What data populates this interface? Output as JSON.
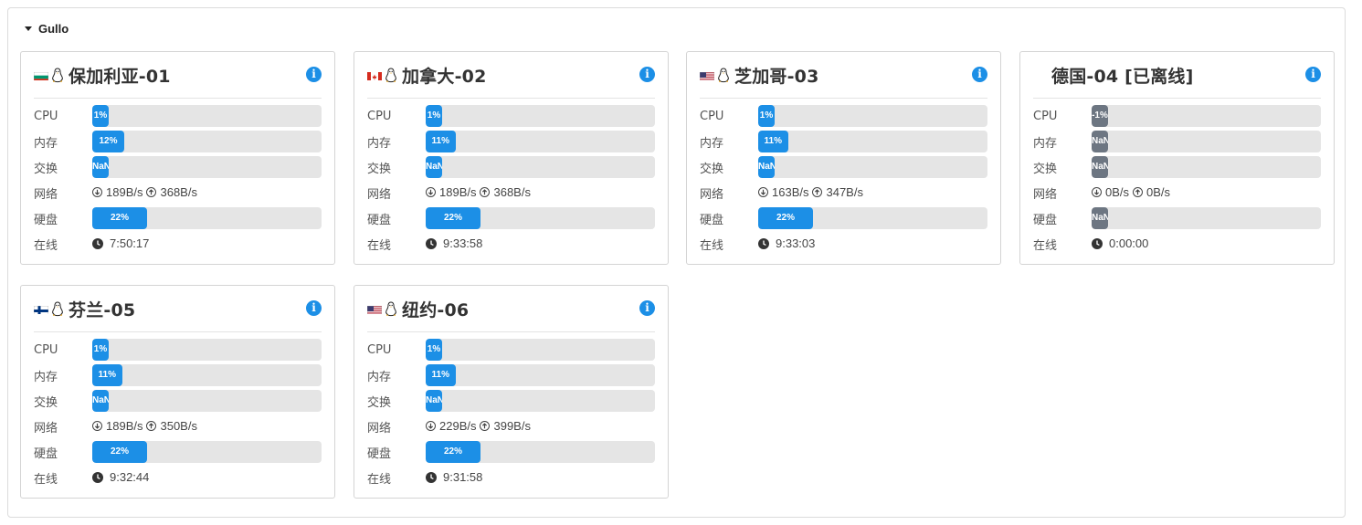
{
  "group": {
    "name": "Gullo"
  },
  "labels": {
    "cpu": "CPU",
    "mem": "内存",
    "swap": "交换",
    "net": "网络",
    "disk": "硬盘",
    "uptime": "在线"
  },
  "colors": {
    "bar_fill": "#1c8fe6",
    "bar_offline": "#6d7682",
    "bar_bg": "#e5e5e5"
  },
  "servers": [
    {
      "flag": "bg",
      "os_icon": "linux-penguin-icon",
      "name": "保加利亚-01",
      "online": true,
      "cpu": "1%",
      "cpu_pct": 1,
      "mem": "12%",
      "mem_pct": 12,
      "swap": "NaN%",
      "swap_pct": 0,
      "net_down": "189B/s",
      "net_up": "368B/s",
      "disk": "22%",
      "disk_pct": 22,
      "uptime": "7:50:17"
    },
    {
      "flag": "ca",
      "os_icon": "linux-penguin-icon",
      "name": "加拿大-02",
      "online": true,
      "cpu": "1%",
      "cpu_pct": 1,
      "mem": "11%",
      "mem_pct": 11,
      "swap": "NaN%",
      "swap_pct": 0,
      "net_down": "189B/s",
      "net_up": "368B/s",
      "disk": "22%",
      "disk_pct": 22,
      "uptime": "9:33:58"
    },
    {
      "flag": "us",
      "os_icon": "linux-penguin-icon",
      "name": "芝加哥-03",
      "online": true,
      "cpu": "1%",
      "cpu_pct": 1,
      "mem": "11%",
      "mem_pct": 11,
      "swap": "NaN%",
      "swap_pct": 0,
      "net_down": "163B/s",
      "net_up": "347B/s",
      "disk": "22%",
      "disk_pct": 22,
      "uptime": "9:33:03"
    },
    {
      "flag": "",
      "os_icon": "",
      "name": "德国-04 [已离线]",
      "online": false,
      "cpu": "-1%",
      "cpu_pct": 0,
      "mem": "NaN%",
      "mem_pct": 0,
      "swap": "NaN%",
      "swap_pct": 0,
      "net_down": "0B/s",
      "net_up": "0B/s",
      "disk": "NaN%",
      "disk_pct": 0,
      "uptime": "0:00:00"
    },
    {
      "flag": "fi",
      "os_icon": "linux-penguin-icon",
      "name": "芬兰-05",
      "online": true,
      "cpu": "1%",
      "cpu_pct": 1,
      "mem": "11%",
      "mem_pct": 11,
      "swap": "NaN%",
      "swap_pct": 0,
      "net_down": "189B/s",
      "net_up": "350B/s",
      "disk": "22%",
      "disk_pct": 22,
      "uptime": "9:32:44"
    },
    {
      "flag": "us",
      "os_icon": "linux-penguin-icon",
      "name": "纽约-06",
      "online": true,
      "cpu": "1%",
      "cpu_pct": 1,
      "mem": "11%",
      "mem_pct": 11,
      "swap": "NaN%",
      "swap_pct": 0,
      "net_down": "229B/s",
      "net_up": "399B/s",
      "disk": "22%",
      "disk_pct": 22,
      "uptime": "9:31:58"
    }
  ]
}
